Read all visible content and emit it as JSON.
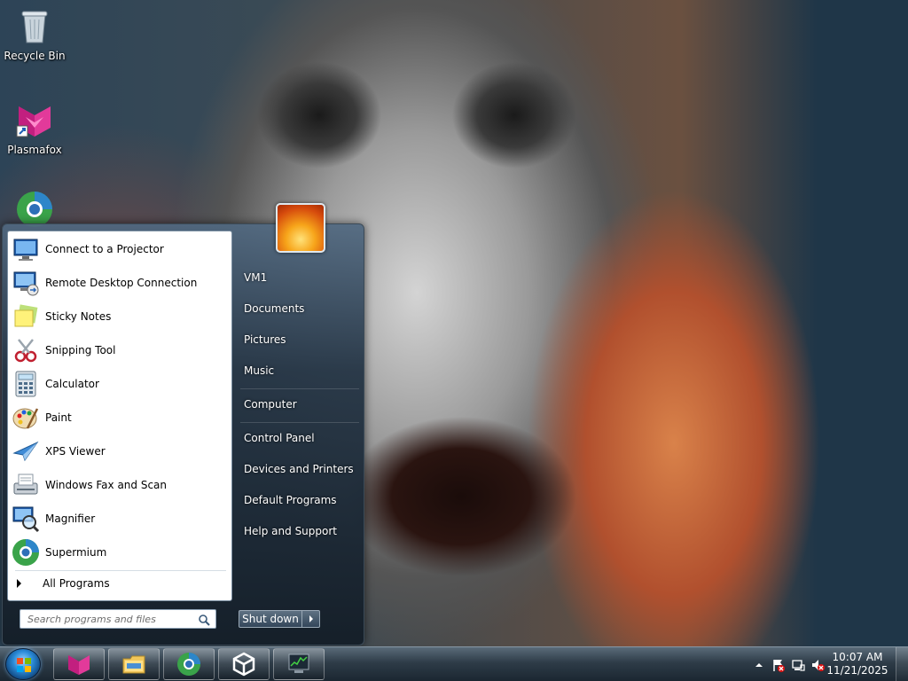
{
  "desktop": {
    "icons": [
      {
        "label": "Recycle Bin",
        "icon": "recycle-bin-icon"
      },
      {
        "label": "Plasmafox",
        "icon": "plasmafox-icon"
      },
      {
        "label": "",
        "icon": "supermium-icon"
      }
    ]
  },
  "start_menu": {
    "programs": [
      {
        "label": "Connect to a Projector",
        "icon": "projector-icon"
      },
      {
        "label": "Remote Desktop Connection",
        "icon": "remote-desktop-icon"
      },
      {
        "label": "Sticky Notes",
        "icon": "sticky-notes-icon"
      },
      {
        "label": "Snipping Tool",
        "icon": "snipping-tool-icon"
      },
      {
        "label": "Calculator",
        "icon": "calculator-icon"
      },
      {
        "label": "Paint",
        "icon": "paint-icon"
      },
      {
        "label": "XPS Viewer",
        "icon": "xps-viewer-icon"
      },
      {
        "label": "Windows Fax and Scan",
        "icon": "fax-scan-icon"
      },
      {
        "label": "Magnifier",
        "icon": "magnifier-icon"
      },
      {
        "label": "Supermium",
        "icon": "supermium-icon"
      }
    ],
    "all_programs": "All Programs",
    "search_placeholder": "Search programs and files",
    "right_items": [
      {
        "label": "VM1"
      },
      {
        "label": "Documents"
      },
      {
        "label": "Pictures"
      },
      {
        "label": "Music"
      },
      {
        "label": "Computer"
      },
      {
        "label": "Control Panel"
      },
      {
        "label": "Devices and Printers"
      },
      {
        "label": "Default Programs"
      },
      {
        "label": "Help and Support"
      }
    ],
    "shutdown_label": "Shut down"
  },
  "taskbar": {
    "pinned": [
      {
        "icon": "plasmafox-icon"
      },
      {
        "icon": "file-explorer-icon"
      },
      {
        "icon": "supermium-icon"
      },
      {
        "icon": "unity-icon"
      },
      {
        "icon": "task-manager-icon"
      }
    ],
    "clock_time": "10:07 AM",
    "clock_date": "11/21/2025"
  }
}
